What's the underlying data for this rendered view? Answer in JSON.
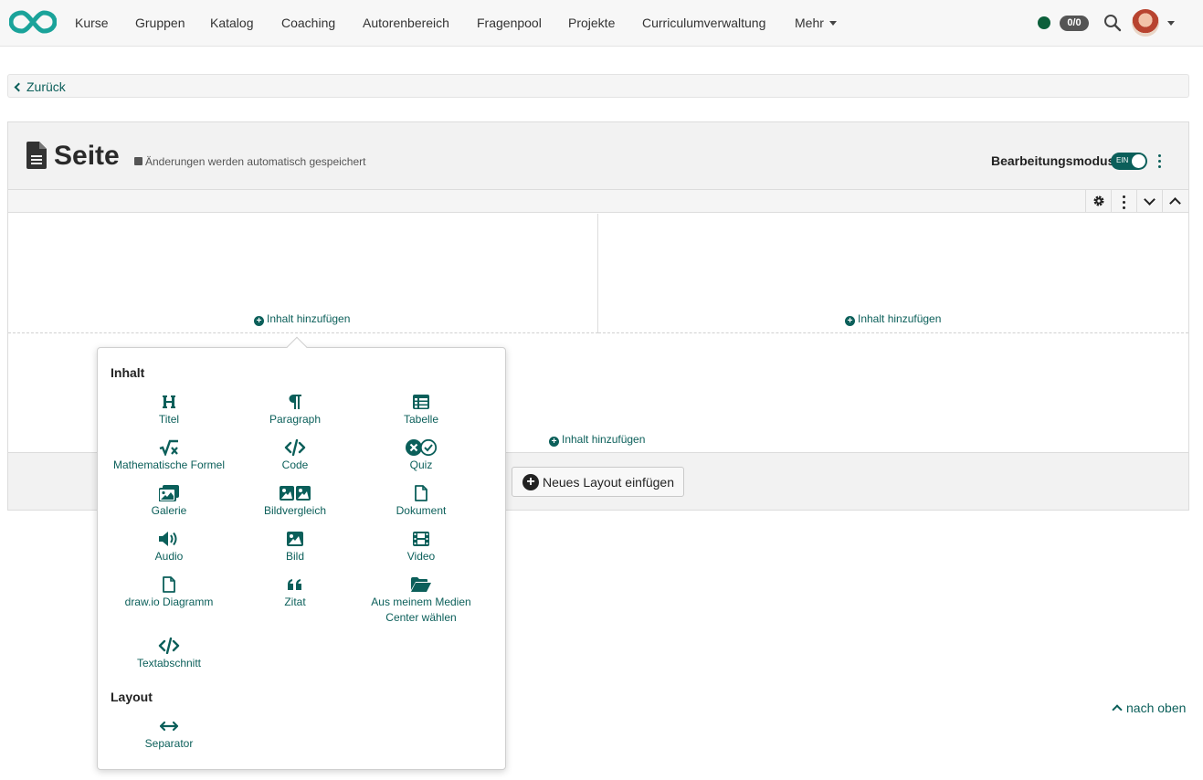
{
  "nav": {
    "items": [
      "Kurse",
      "Gruppen",
      "Katalog",
      "Coaching",
      "Autorenbereich",
      "Fragenpool",
      "Projekte",
      "Curriculumverwaltung",
      "Mehr"
    ],
    "badge": "0/0",
    "status_color": "#0b5f3a"
  },
  "back": {
    "label": "Zurück"
  },
  "page": {
    "title": "Seite",
    "save_hint": "Änderungen werden automatisch gespeichert",
    "edit_mode_label": "Bearbeitungsmodus",
    "toggle_text": "EIN"
  },
  "cells": {
    "add_content": "Inhalt hinzufügen"
  },
  "new_layout": {
    "label": "Neues Layout einfügen"
  },
  "popover": {
    "section_content": "Inhalt",
    "section_layout": "Layout",
    "items": [
      {
        "label": "Titel",
        "icon": "heading-icon"
      },
      {
        "label": "Paragraph",
        "icon": "paragraph-icon"
      },
      {
        "label": "Tabelle",
        "icon": "table-icon"
      },
      {
        "label": "Mathematische Formel",
        "icon": "square-root-icon"
      },
      {
        "label": "Code",
        "icon": "code-icon"
      },
      {
        "label": "Quiz",
        "icon": "quiz-icon"
      },
      {
        "label": "Galerie",
        "icon": "gallery-icon"
      },
      {
        "label": "Bildvergleich",
        "icon": "image-compare-icon"
      },
      {
        "label": "Dokument",
        "icon": "file-icon"
      },
      {
        "label": "Audio",
        "icon": "volume-icon"
      },
      {
        "label": "Bild",
        "icon": "image-icon"
      },
      {
        "label": "Video",
        "icon": "film-icon"
      },
      {
        "label": "draw.io Diagramm",
        "icon": "file-icon"
      },
      {
        "label": "Zitat",
        "icon": "quote-icon"
      },
      {
        "label": "Aus meinem Medien Center wählen",
        "icon": "folder-open-icon"
      },
      {
        "label": "Textabschnitt",
        "icon": "code-icon"
      }
    ],
    "layout_items": [
      {
        "label": "Separator",
        "icon": "arrows-horizontal-icon"
      }
    ]
  },
  "to_top": {
    "label": "nach oben"
  },
  "colors": {
    "accent": "#0b5f5a",
    "dark": "#222222"
  }
}
